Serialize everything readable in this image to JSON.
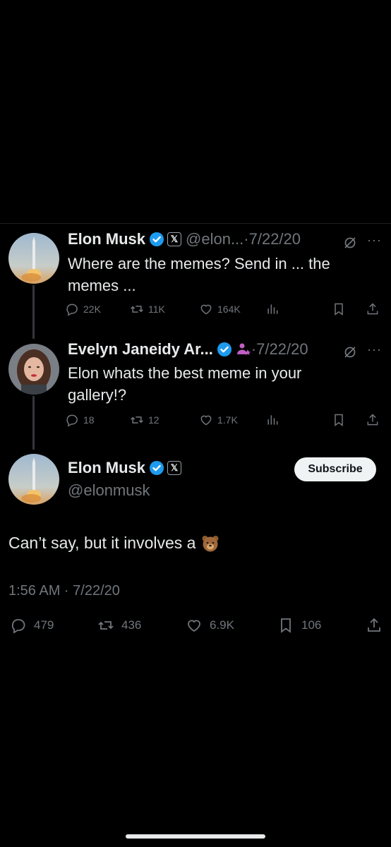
{
  "colors": {
    "background": "#000000",
    "text": "#e7e9ea",
    "muted": "#71767b",
    "verified": "#1d9bf0",
    "subscribe_bg": "#eff3f4"
  },
  "thread": [
    {
      "author": "Elon Musk",
      "handle_time": "@elon...·7/22/20",
      "text": "Where are the memes? Send in ... the memes ...",
      "more": "···",
      "replies": "22K",
      "reposts": "11K",
      "likes": "164K",
      "icons": [
        "verified-badge",
        "x-affiliate-badge",
        "grok-icon",
        "more-icon",
        "reply-icon",
        "repost-icon",
        "like-icon",
        "views-icon",
        "bookmark-icon",
        "share-icon"
      ]
    },
    {
      "author": "Evelyn Janeidy Ar...",
      "handle_time": "·7/22/20",
      "text": "Elon whats the best meme in your gallery!?",
      "more": "···",
      "replies": "18",
      "reposts": "12",
      "likes": "1.7K",
      "icons": [
        "verified-badge",
        "subscriber-badge",
        "grok-icon",
        "more-icon",
        "reply-icon",
        "repost-icon",
        "like-icon",
        "views-icon",
        "bookmark-icon",
        "share-icon"
      ]
    }
  ],
  "main": {
    "author": "Elon Musk",
    "handle": "@elonmusk",
    "subscribe_label": "Subscribe",
    "text": "Can’t say, but it involves a",
    "emoji": "bear-face",
    "timestamp": "1:56 AM · 7/22/20",
    "replies": "479",
    "reposts": "436",
    "likes": "6.9K",
    "bookmarks": "106"
  }
}
